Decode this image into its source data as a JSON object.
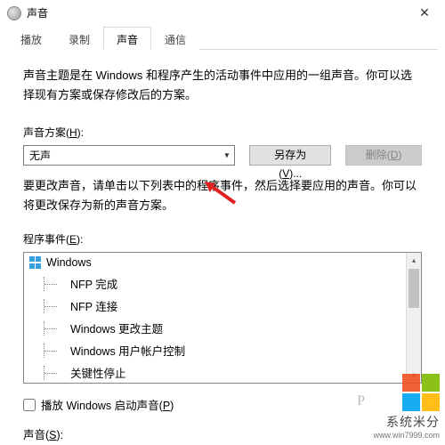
{
  "window": {
    "title": "声音"
  },
  "tabs": [
    "播放",
    "录制",
    "声音",
    "通信"
  ],
  "active_tab_index": 2,
  "sound": {
    "description": "声音主题是在 Windows 和程序产生的活动事件中应用的一组声音。你可以选择现有方案或保存修改后的方案。",
    "scheme_label": "声音方案(H):",
    "scheme_value": "无声",
    "save_as_btn": "另存为(V)...",
    "delete_btn": "删除(D)",
    "change_hint": "要更改声音，请单击以下列表中的程序事件，然后选择要应用的声音。你可以将更改保存为新的声音方案。",
    "events_label": "程序事件(E):",
    "tree_root": "Windows",
    "tree_items": [
      "NFP 完成",
      "NFP 连接",
      "Windows 更改主题",
      "Windows 用户帐户控制",
      "关键性停止"
    ],
    "play_startup_label": "播放 Windows 启动声音(P)",
    "play_startup_checked": false,
    "sounds_label": "声音(S):"
  },
  "watermark": {
    "brand": "系统米分",
    "url": "www.win7999.com",
    "p": "P"
  }
}
